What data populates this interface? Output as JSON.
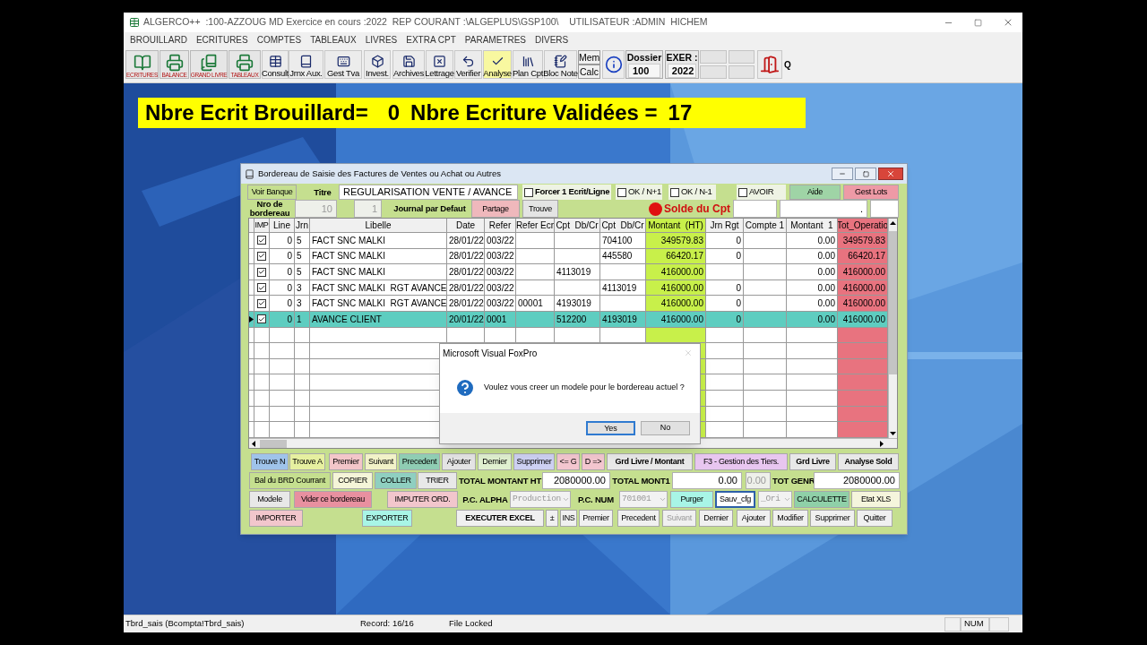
{
  "app": {
    "title": "ALGERCO++  :100-AZZOUG MD Exercice en cours :2022  REP COURANT :\\ALGEPLUS\\GSP100\\    UTILISATEUR :ADMIN  HICHEM"
  },
  "menu": [
    "BROUILLARD",
    "ECRITURES",
    "COMPTES",
    "TABLEAUX",
    "LIVRES",
    "EXTRA CPT",
    "PARAMETRES",
    "DIVERS"
  ],
  "toolbar": [
    {
      "kind": "big",
      "label": "ECRITURES"
    },
    {
      "kind": "big",
      "label": "BALANCE"
    },
    {
      "kind": "big",
      "label": "GRAND LIVRE"
    },
    {
      "kind": "big",
      "label": "TABLEAUX"
    },
    {
      "kind": "tool",
      "label": "Consult"
    },
    {
      "kind": "tool",
      "label": "Jrnx Aux."
    },
    {
      "kind": "tool",
      "label": "Gest Tva"
    },
    {
      "kind": "tool",
      "label": "Invest."
    },
    {
      "kind": "tool",
      "label": "Archives"
    },
    {
      "kind": "tool",
      "label": "Lettrage"
    },
    {
      "kind": "tool",
      "label": "Verifier"
    },
    {
      "kind": "tool",
      "label": "Analyse"
    },
    {
      "kind": "tool",
      "label": "Plan Cpt"
    },
    {
      "kind": "tool",
      "label": "Bloc Note"
    },
    {
      "kind": "stack",
      "lines": [
        "Mem",
        "Calc"
      ]
    },
    {
      "kind": "info"
    },
    {
      "kind": "field",
      "label": "Dossier",
      "value": "100"
    },
    {
      "kind": "field",
      "label": "EXER :",
      "value": "2022"
    },
    {
      "kind": "blank"
    },
    {
      "kind": "exit"
    },
    {
      "kind": "text",
      "label": "Q"
    }
  ],
  "banner": {
    "brouillard_label": "Nbre Ecrit Brouillard=",
    "brouillard_count": "0",
    "valid_label": "Nbre Ecriture Validées =",
    "valid_count": "17"
  },
  "form": {
    "title": "Bordereau de Saisie des Factures de Ventes ou Achat ou Autres",
    "header_rows": [
      [
        {
          "kind": "button",
          "text": "Voir Banque",
          "color": "#c5df8f",
          "disabled": false
        },
        {
          "kind": "label",
          "text": "Titre"
        },
        {
          "kind": "field",
          "value": "REGULARISATION VENTE / AVANCE",
          "disabled": false
        },
        {
          "kind": "check",
          "text": "Forcer 1 Ecrit/Ligne",
          "checked": false
        },
        {
          "kind": "check",
          "text": "OK / N+1",
          "checked": false
        },
        {
          "kind": "check",
          "text": "OK / N-1",
          "checked": false
        },
        {
          "kind": "check",
          "text": "AVOIR",
          "checked": false
        },
        {
          "kind": "button",
          "text": "Aide",
          "color": "#9fd4a6",
          "disabled": false
        },
        {
          "kind": "button",
          "text": "Gest Lots",
          "color": "#ee9aa6",
          "disabled": false
        }
      ],
      [
        {
          "kind": "label",
          "text": "Nro de bordereau"
        },
        {
          "kind": "field",
          "value": "10",
          "disabled": true
        },
        {
          "kind": "field",
          "value": "1",
          "disabled": true
        },
        {
          "kind": "label",
          "text": "Journal par Defaut"
        },
        {
          "kind": "button",
          "text": "Partage",
          "color": "#efb8bc",
          "disabled": false
        },
        {
          "kind": "button",
          "text": "Trouve",
          "color": "#e4e4e4",
          "disabled": false
        },
        {
          "kind": "dot",
          "color": "#e01010"
        },
        {
          "kind": "heading",
          "text": "Solde du Cpt"
        },
        {
          "kind": "field",
          "disabled": false
        },
        {
          "kind": "field",
          "value": ".",
          "disabled": false
        },
        {
          "kind": "field",
          "disabled": false
        }
      ]
    ],
    "imp_header": "IMP",
    "columns": [
      "Line",
      "Jrn",
      "Libelle",
      "Date",
      "Refer",
      "Refer Ecr",
      "Cpt  Db/Cr",
      "Cpt  Db/Cr",
      "Montant  (HT)",
      "Jrn Rgt",
      "Compte 1",
      "Montant  1",
      "Tot_Operatio"
    ],
    "rows": [
      {
        "selected": false,
        "imp": true,
        "cells": [
          "0",
          "5",
          "FACT SNC MALKI",
          "28/01/22",
          "003/22",
          null,
          null,
          "704100",
          "349579.83",
          "0",
          null,
          "0.00",
          "349579.83"
        ]
      },
      {
        "selected": false,
        "imp": true,
        "cells": [
          "0",
          "5",
          "FACT SNC MALKI",
          "28/01/22",
          "003/22",
          null,
          null,
          "445580",
          "66420.17",
          "0",
          null,
          "0.00",
          "66420.17"
        ]
      },
      {
        "selected": false,
        "imp": true,
        "cells": [
          "0",
          "5",
          "FACT SNC MALKI",
          "28/01/22",
          "003/22",
          null,
          "4113019",
          null,
          "416000.00",
          null,
          null,
          "0.00",
          "416000.00"
        ]
      },
      {
        "selected": false,
        "imp": true,
        "cells": [
          "0",
          "3",
          "FACT SNC MALKI  RGT AVANCE",
          "28/01/22",
          "003/22",
          null,
          null,
          "4113019",
          "416000.00",
          "0",
          null,
          "0.00",
          "416000.00"
        ]
      },
      {
        "selected": false,
        "imp": true,
        "cells": [
          "0",
          "3",
          "FACT SNC MALKI  RGT AVANCE",
          "28/01/22",
          "003/22",
          "00001",
          "4193019",
          null,
          "416000.00",
          "0",
          null,
          "0.00",
          "416000.00"
        ]
      },
      {
        "selected": true,
        "imp": true,
        "cells": [
          "0",
          "1",
          "AVANCE CLIENT",
          "20/01/22",
          "0001",
          null,
          "512200",
          "4193019",
          "416000.00",
          "0",
          null,
          "0.00",
          "416000.00"
        ]
      }
    ],
    "button_rows": [
      [
        {
          "kind": "button",
          "text": "Trouve N",
          "color": "#9fc3ea",
          "disabled": false
        },
        {
          "kind": "button",
          "text": "Trouve A",
          "color": "#e6f0a0",
          "disabled": false
        },
        {
          "kind": "button",
          "text": "Premier",
          "color": "#f3c6c9",
          "disabled": false
        },
        {
          "kind": "button",
          "text": "Suivant",
          "color": "#f2f2c8",
          "disabled": false
        },
        {
          "kind": "button",
          "text": "Precedent",
          "color": "#8fcdb3",
          "disabled": false
        },
        {
          "kind": "button",
          "text": "Ajouter",
          "color": "#e4e4e4",
          "disabled": false
        },
        {
          "kind": "button",
          "text": "Dernier",
          "color": "#e0f0d0",
          "disabled": false
        },
        {
          "kind": "button",
          "text": "Supprimer",
          "color": "#cdd0f2",
          "disabled": false
        },
        {
          "kind": "button",
          "text": "<= G",
          "color": "#f3c6cf",
          "disabled": false
        },
        {
          "kind": "button",
          "text": "D =>",
          "color": "#f3c6cf",
          "disabled": false
        },
        {
          "kind": "bold-button",
          "text": "Grd Livre / Montant",
          "color": "#e8e8e8",
          "disabled": false
        },
        {
          "kind": "button",
          "text": "F3 - Gestion des Tiers.",
          "color": "#e8c6f0",
          "disabled": false
        },
        {
          "kind": "bold-button",
          "text": "Grd Livre",
          "color": "#e8e8e8",
          "disabled": false
        },
        {
          "kind": "bold-button",
          "text": "Analyse Sold",
          "color": "#e8e8e8",
          "disabled": false
        }
      ],
      [
        {
          "kind": "button",
          "text": "Bal du BRD Courrant",
          "color": "#c5df8f",
          "disabled": false
        },
        {
          "kind": "button",
          "text": "COPIER",
          "color": "#f5f5d8",
          "disabled": false
        },
        {
          "kind": "button",
          "text": "COLLER",
          "color": "#8fcfc0",
          "disabled": false
        },
        {
          "kind": "button",
          "text": "TRIER",
          "color": "#e8e8e8",
          "disabled": false
        },
        {
          "kind": "label",
          "text": "TOTAL  MONTANT HT"
        },
        {
          "kind": "field",
          "value": "2080000.00",
          "disabled": false
        },
        {
          "kind": "label",
          "text": "TOTAL  MONT1"
        },
        {
          "kind": "field",
          "value": "0.00",
          "disabled": false
        },
        {
          "kind": "field",
          "value": "0.00",
          "disabled": true
        },
        {
          "kind": "label",
          "text": "TOT GENR"
        },
        {
          "kind": "field",
          "value": "2080000.00",
          "disabled": false
        }
      ],
      [
        {
          "kind": "button",
          "text": "Modele",
          "color": "#e8e8e8",
          "disabled": false
        },
        {
          "kind": "button",
          "text": "Vider ce bordereau",
          "color": "#e890a0",
          "disabled": false
        },
        {
          "kind": "button",
          "text": "IMPUTER ORD.",
          "color": "#f2c6cc",
          "disabled": false
        },
        {
          "kind": "label",
          "text": "P.C. ALPHA"
        },
        {
          "kind": "combo",
          "value": "Production",
          "disabled": true
        },
        {
          "kind": "label",
          "text": "P.C.  NUM"
        },
        {
          "kind": "combo",
          "value": "701001",
          "disabled": true
        },
        {
          "kind": "button",
          "text": "Purger",
          "color": "#a8f5e6",
          "disabled": false
        },
        {
          "kind": "default-button",
          "text": "Sauv_cfg",
          "color": "#ffffff",
          "disabled": false
        },
        {
          "kind": "combo",
          "value": "_Ori",
          "disabled": true
        },
        {
          "kind": "button",
          "text": "CALCULETTE",
          "color": "#8fd0a8",
          "disabled": false
        },
        {
          "kind": "button",
          "text": "Etat XLS",
          "color": "#f5f5dc",
          "disabled": false
        }
      ],
      [
        {
          "kind": "button",
          "text": "IMPORTER",
          "color": "#f2c6cc",
          "disabled": false
        },
        {
          "kind": "button",
          "text": "EXPORTER",
          "color": "#a8f5e6",
          "disabled": false
        },
        {
          "kind": "bold-button",
          "text": "EXECUTER  EXCEL",
          "color": "#f0f0f0",
          "disabled": false
        },
        {
          "kind": "button",
          "text": "±",
          "color": "#f0f0f0",
          "disabled": false
        },
        {
          "kind": "button",
          "text": "INS",
          "color": "#f0f0f0",
          "disabled": false
        },
        {
          "kind": "button",
          "text": "Premier",
          "color": "#f0f0f0",
          "disabled": false
        },
        {
          "kind": "button",
          "text": "Precedent",
          "color": "#f0f0f0",
          "disabled": false
        },
        {
          "kind": "button",
          "text": "Suivant",
          "color": "#f0f0f0",
          "disabled": true
        },
        {
          "kind": "button",
          "text": "Dernier",
          "color": "#f0f0f0",
          "disabled": false
        },
        {
          "kind": "button",
          "text": "Ajouter",
          "color": "#f0f0f0",
          "disabled": false
        },
        {
          "kind": "button",
          "text": "Modifier",
          "color": "#f0f0f0",
          "disabled": false
        },
        {
          "kind": "button",
          "text": "Supprimer",
          "color": "#f0f0f0",
          "disabled": false
        },
        {
          "kind": "button",
          "text": "Quitter",
          "color": "#f0f0f0",
          "disabled": false
        }
      ]
    ]
  },
  "dialog": {
    "title": "Microsoft Visual FoxPro",
    "message": "Voulez vous creer un modele pour le bordereau actuel ?",
    "buttons": [
      {
        "text": "Yes",
        "selected": true
      },
      {
        "text": "No",
        "selected": false
      }
    ]
  },
  "status_bar": [
    "Tbrd_sais (Bcompta!Tbrd_sais)",
    "Record: 16/16",
    "File Locked",
    "NUM"
  ]
}
